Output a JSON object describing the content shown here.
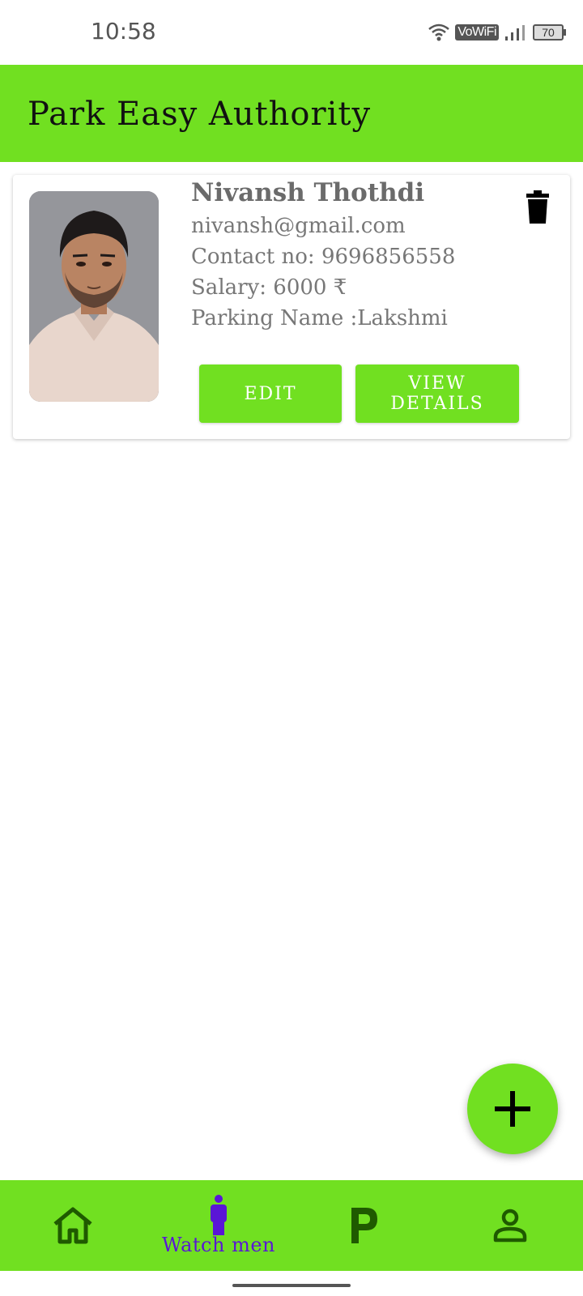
{
  "status_bar": {
    "time": "10:58",
    "vowifi_label": "VoWiFi",
    "battery_level": "70"
  },
  "app_bar": {
    "title": "Park Easy Authority"
  },
  "watchman_card": {
    "name": "Nivansh Thothdi",
    "email": "nivansh@gmail.com",
    "contact": "Contact no: 9696856558",
    "salary": "Salary: 6000 ₹",
    "parking": "Parking Name :Lakshmi",
    "edit_label": "EDIT",
    "view_label": "VIEW DETAILS",
    "delete_icon": "trash-icon",
    "photo": "profile-photo"
  },
  "fab": {
    "icon": "plus-icon"
  },
  "bottom_nav": {
    "items": [
      {
        "icon": "home-icon",
        "label": ""
      },
      {
        "icon": "person-standing-icon",
        "label": "Watch men",
        "active": true
      },
      {
        "icon": "parking-icon",
        "label": ""
      },
      {
        "icon": "account-icon",
        "label": ""
      }
    ]
  },
  "colors": {
    "primary": "#71e021",
    "active_nav": "#5a16d6",
    "icon_dark": "#1f5a00"
  }
}
